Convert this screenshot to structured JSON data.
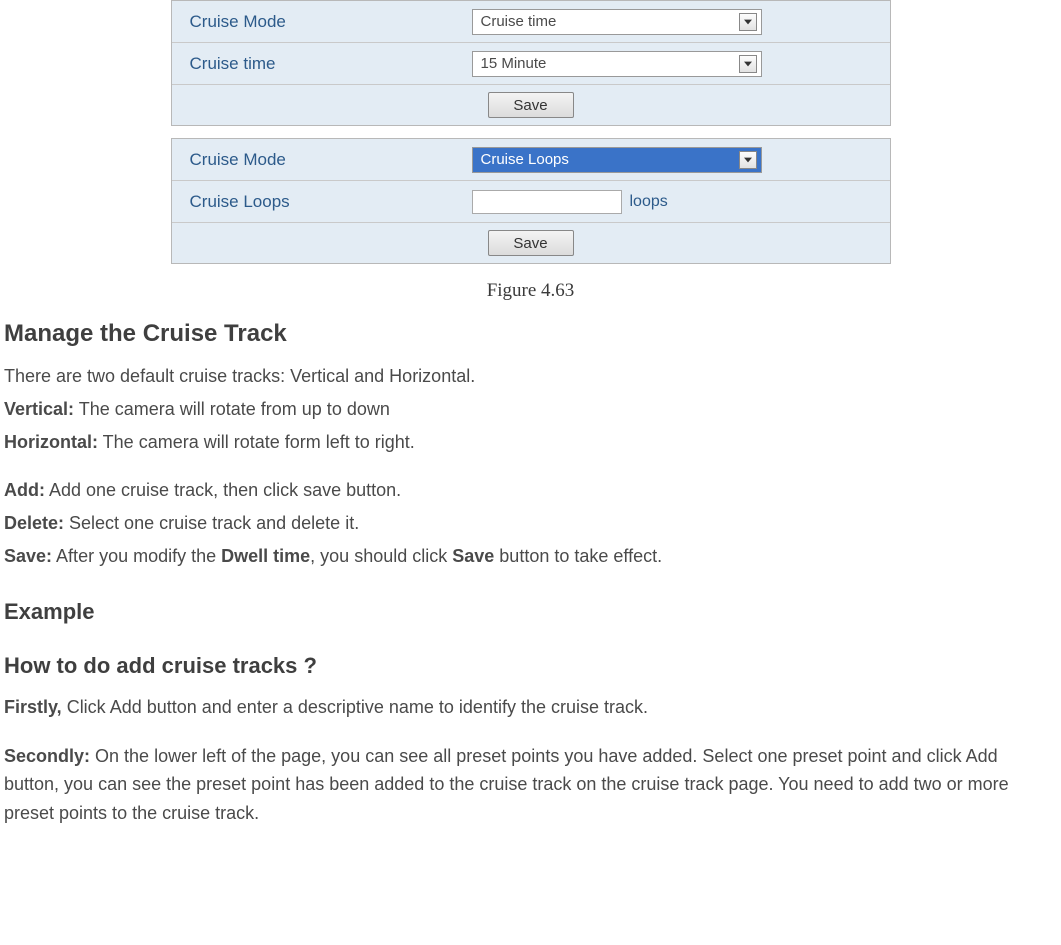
{
  "panel1": {
    "cruise_mode_label": "Cruise Mode",
    "cruise_mode_value": "Cruise time",
    "cruise_time_label": "Cruise time",
    "cruise_time_value": "15 Minute",
    "save": "Save"
  },
  "panel2": {
    "cruise_mode_label": "Cruise Mode",
    "cruise_mode_value": "Cruise Loops",
    "cruise_loops_label": "Cruise Loops",
    "cruise_loops_suffix": "loops",
    "save": "Save"
  },
  "figure_caption": "Figure 4.63",
  "heading_manage": "Manage the Cruise Track",
  "manage_intro": "There are two default cruise tracks: Vertical and Horizontal.",
  "vertical_label": "Vertical:",
  "vertical_text": " The camera will rotate from up to down",
  "horizontal_label": "Horizontal:",
  "horizontal_text": " The camera will rotate form left to right.",
  "add_label": "Add:",
  "add_text": " Add one cruise track, then click save button.",
  "delete_label": "Delete:",
  "delete_text": " Select one cruise track and delete it.",
  "save_label": "Save:",
  "save_text_a": " After you modify the ",
  "save_text_b": "Dwell time",
  "save_text_c": ", you should click ",
  "save_text_d": "Save",
  "save_text_e": " button to take effect.",
  "heading_example": "Example",
  "heading_how": "How to do add cruise tracks ?",
  "firstly_label": "Firstly,",
  "firstly_text": " Click Add button and enter a descriptive name to identify the cruise track.",
  "secondly_label": "Secondly:",
  "secondly_text": " On the lower left of the page, you can see all preset points you have added. Select one preset point and click Add button, you can see the preset point has been added to the cruise track on the cruise track page. You need to add two or more preset points to the cruise track."
}
